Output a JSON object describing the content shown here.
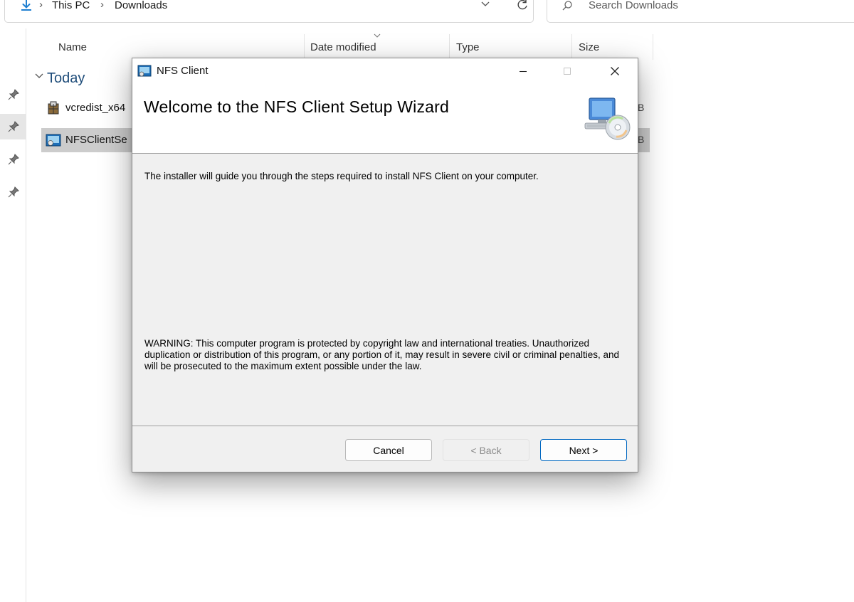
{
  "explorer": {
    "breadcrumb": [
      "This PC",
      "Downloads"
    ],
    "search_placeholder": "Search Downloads",
    "columns": [
      "Name",
      "Date modified",
      "Type",
      "Size"
    ],
    "group": "Today",
    "files": [
      {
        "name": "vcredist_x64",
        "size_tail": "B"
      },
      {
        "name": "NFSClientSe",
        "size_tail": "B"
      }
    ]
  },
  "dialog": {
    "title": "NFS Client",
    "heading": "Welcome to the NFS Client Setup Wizard",
    "intro": "The installer will guide you through the steps required to install NFS Client on your computer.",
    "warning": "WARNING: This computer program is protected by copyright law and international treaties. Unauthorized duplication or distribution of this program, or any portion of it, may result in severe civil or criminal penalties, and will be prosecuted to the maximum extent possible under the law.",
    "buttons": {
      "cancel": "Cancel",
      "back": "< Back",
      "next": "Next >"
    },
    "window_controls": {
      "minimize": "minimize-icon",
      "maximize": "maximize-icon",
      "close": "close-icon"
    }
  },
  "colors": {
    "accent": "#0067c0",
    "selection": "#cccccc",
    "dialog_bg": "#f0f0f0",
    "group_header": "#1f4d7a"
  }
}
